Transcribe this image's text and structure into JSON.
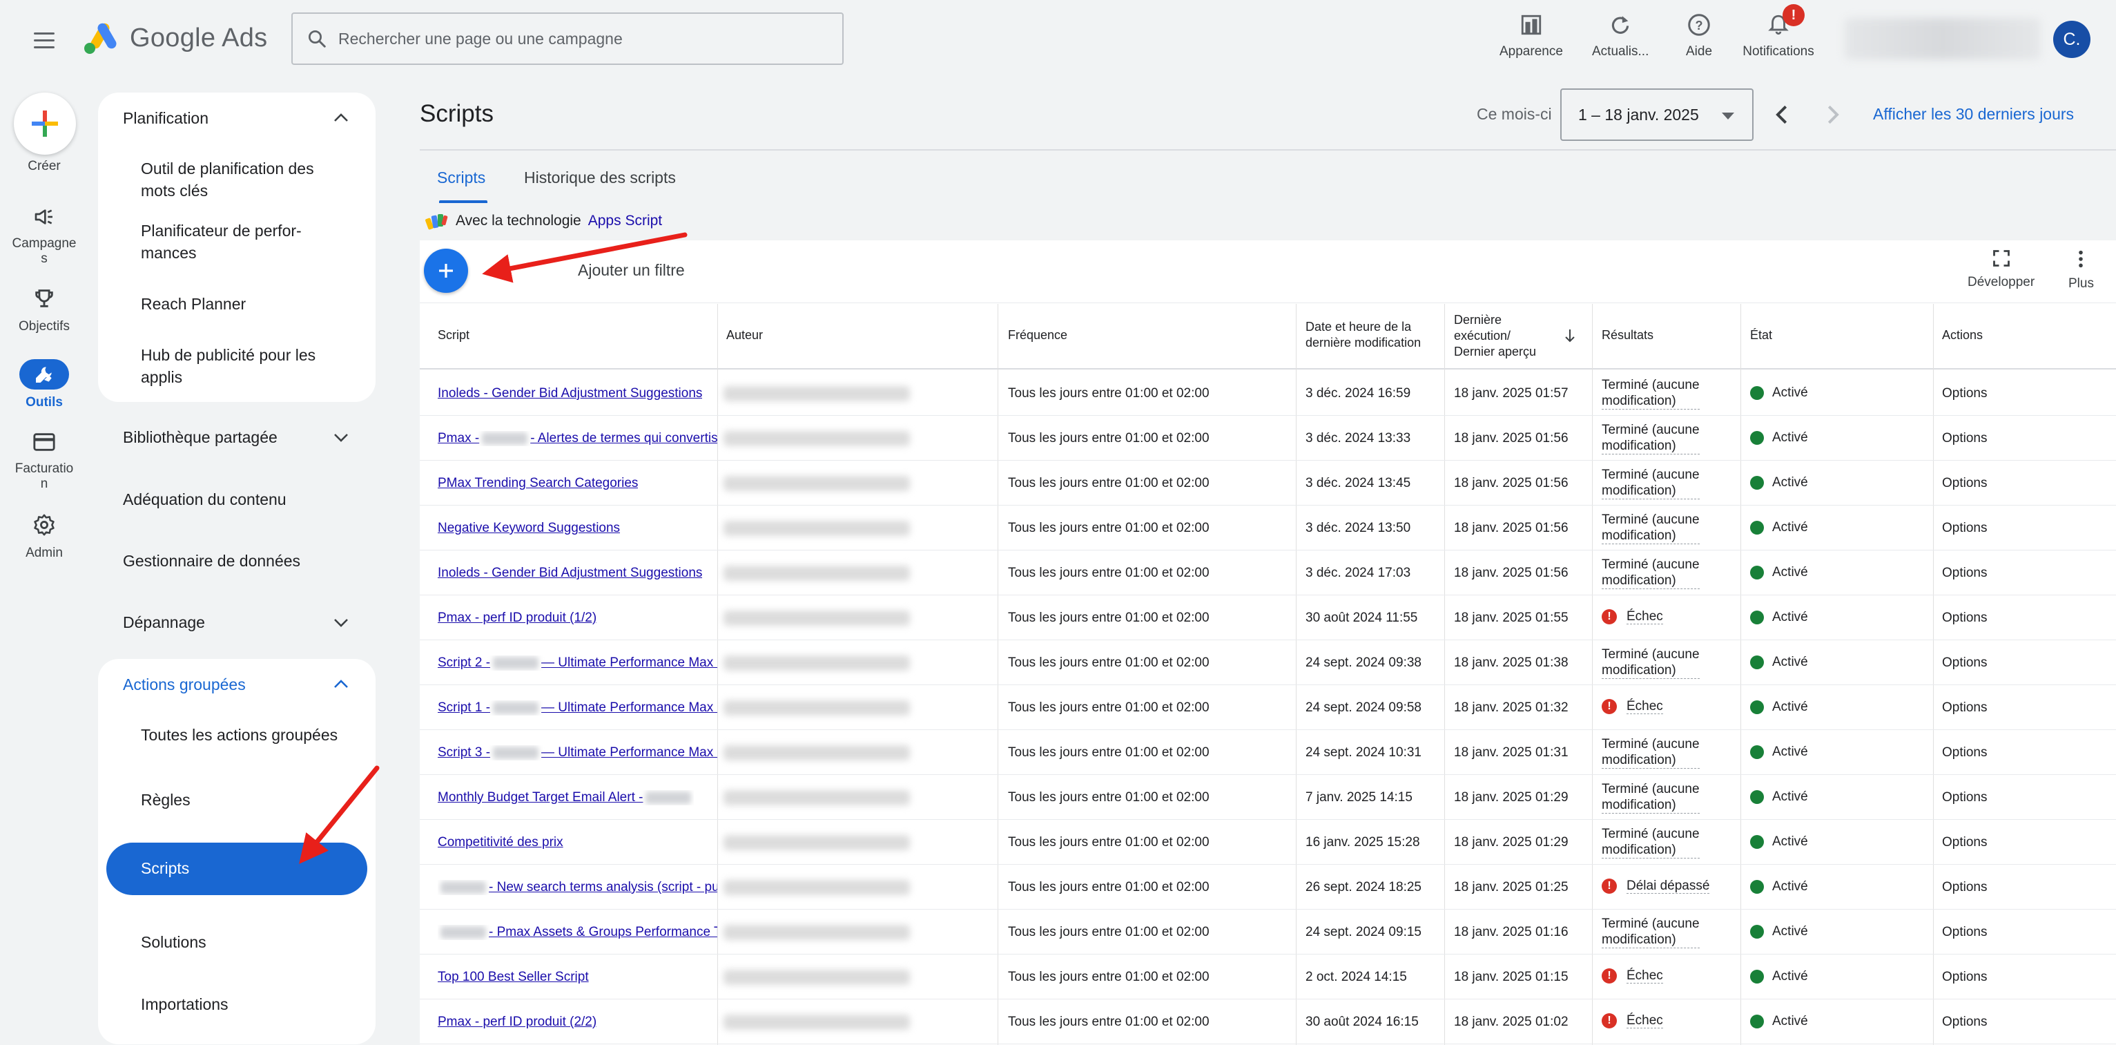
{
  "header": {
    "logo_text": "Google Ads",
    "search_placeholder": "Rechercher une page ou une campagne",
    "tools": [
      {
        "label": "Apparence"
      },
      {
        "label": "Actualis..."
      },
      {
        "label": "Aide"
      },
      {
        "label": "Notifications",
        "badge": "!"
      }
    ],
    "avatar_initial": "C."
  },
  "rail": {
    "create": "Créer",
    "items": [
      {
        "label_line1": "Campagne",
        "label_line2": "s"
      },
      {
        "label_line1": "Objectifs",
        "label_line2": ""
      },
      {
        "label_line1": "Outils",
        "label_line2": "",
        "active": true
      },
      {
        "label_line1": "Facturatio",
        "label_line2": "n"
      },
      {
        "label_line1": "Admin",
        "label_line2": ""
      }
    ]
  },
  "sidebar": {
    "planification": {
      "title": "Planification",
      "items": [
        "Outil de planification des mots clés",
        "Planificateur de perfor­mances",
        "Reach Planner",
        "Hub de publicité pour les applis"
      ]
    },
    "plain": [
      "Bibliothèque partagée",
      "Adéquation du contenu",
      "Gestionnaire de données",
      "Dépannage"
    ],
    "actions": {
      "title": "Actions groupées",
      "items": [
        "Toutes les actions grou­pées",
        "Règles",
        "Scripts",
        "Solutions",
        "Importations"
      ]
    }
  },
  "main": {
    "title": "Scripts",
    "period_label": "Ce mois-ci",
    "date_range": "1 – 18 janv. 2025",
    "last30": "Afficher les 30 derniers jours",
    "tabs": [
      "Scripts",
      "Historique des scripts"
    ],
    "powered_by": "Avec la technologie",
    "powered_link": "Apps Script",
    "add_filter": "Ajouter un filtre",
    "toolbar": {
      "expand": "Développer",
      "more": "Plus"
    },
    "columns": {
      "script": "Script",
      "author": "Auteur",
      "frequency": "Fréquence",
      "modified_1": "Date et heure de la",
      "modified_2": "dernière modification",
      "last_run_1": "Dernière",
      "last_run_2": "exécution/",
      "last_run_3": "Dernier aperçu",
      "results": "Résultats",
      "state": "État",
      "actions": "Actions"
    },
    "rows": [
      {
        "script_pre": "",
        "script": "Inoleds - Gender Bid Adjustment Suggestions",
        "frequency": "Tous les jours entre 01:00 et 02:00",
        "modified": "3 déc. 2024 16:59",
        "last_run": "18 janv. 2025 01:57",
        "result_1": "Terminé (aucune",
        "result_2": "modification)",
        "status": "Activé",
        "action": "Options"
      },
      {
        "script_pre": "Pmax -",
        "script": "- Alertes de termes qui convertis",
        "frequency": "Tous les jours entre 01:00 et 02:00",
        "modified": "3 déc. 2024 13:33",
        "last_run": "18 janv. 2025 01:56",
        "result_1": "Terminé (aucune",
        "result_2": "modification)",
        "status": "Activé",
        "action": "Options"
      },
      {
        "script_pre": "",
        "script": "PMax Trending Search Categories",
        "frequency": "Tous les jours entre 01:00 et 02:00",
        "modified": "3 déc. 2024 13:45",
        "last_run": "18 janv. 2025 01:56",
        "result_1": "Terminé (aucune",
        "result_2": "modification)",
        "status": "Activé",
        "action": "Options"
      },
      {
        "script_pre": "",
        "script": "Negative Keyword Suggestions",
        "frequency": "Tous les jours entre 01:00 et 02:00",
        "modified": "3 déc. 2024 13:50",
        "last_run": "18 janv. 2025 01:56",
        "result_1": "Terminé (aucune",
        "result_2": "modification)",
        "status": "Activé",
        "action": "Options"
      },
      {
        "script_pre": "",
        "script": "Inoleds - Gender Bid Adjustment Suggestions",
        "frequency": "Tous les jours entre 01:00 et 02:00",
        "modified": "3 déc. 2024 17:03",
        "last_run": "18 janv. 2025 01:56",
        "result_1": "Terminé (aucune",
        "result_2": "modification)",
        "status": "Activé",
        "action": "Options"
      },
      {
        "script_pre": "",
        "script": "Pmax - perf ID produit (1/2)",
        "frequency": "Tous les jours entre 01:00 et 02:00",
        "modified": "30 août 2024 11:55",
        "last_run": "18 janv. 2025 01:55",
        "result_error": "Échec",
        "status": "Activé",
        "action": "Options"
      },
      {
        "script_pre": "Script 2 -",
        "script": "— Ultimate Performance Max I",
        "frequency": "Tous les jours entre 01:00 et 02:00",
        "modified": "24 sept. 2024 09:38",
        "last_run": "18 janv. 2025 01:38",
        "result_1": "Terminé (aucune",
        "result_2": "modification)",
        "status": "Activé",
        "action": "Options"
      },
      {
        "script_pre": "Script 1 -",
        "script": "— Ultimate Performance Max I",
        "frequency": "Tous les jours entre 01:00 et 02:00",
        "modified": "24 sept. 2024 09:58",
        "last_run": "18 janv. 2025 01:32",
        "result_error": "Échec",
        "status": "Activé",
        "action": "Options"
      },
      {
        "script_pre": "Script 3 -",
        "script": "— Ultimate Performance Max I",
        "frequency": "Tous les jours entre 01:00 et 02:00",
        "modified": "24 sept. 2024 10:31",
        "last_run": "18 janv. 2025 01:31",
        "result_1": "Terminé (aucune",
        "result_2": "modification)",
        "status": "Activé",
        "action": "Options"
      },
      {
        "script_pre": "",
        "script": "Monthly Budget Target Email Alert -",
        "frequency": "Tous les jours entre 01:00 et 02:00",
        "modified": "7 janv. 2025 14:15",
        "last_run": "18 janv. 2025 01:29",
        "result_1": "Terminé (aucune",
        "result_2": "modification)",
        "status": "Activé",
        "action": "Options"
      },
      {
        "script_pre": "",
        "script": "Competitivité des prix",
        "frequency": "Tous les jours entre 01:00 et 02:00",
        "modified": "16 janv. 2025 15:28",
        "last_run": "18 janv. 2025 01:29",
        "result_1": "Terminé (aucune",
        "result_2": "modification)",
        "status": "Activé",
        "action": "Options"
      },
      {
        "script_pre": "",
        "script": "- New search terms analysis (script - pul",
        "frequency": "Tous les jours entre 01:00 et 02:00",
        "modified": "26 sept. 2024 18:25",
        "last_run": "18 janv. 2025 01:25",
        "result_error": "Délai dépassé",
        "status": "Activé",
        "action": "Options"
      },
      {
        "script_pre": "",
        "script": "- Pmax Assets & Groups Performance T",
        "frequency": "Tous les jours entre 01:00 et 02:00",
        "modified": "24 sept. 2024 09:15",
        "last_run": "18 janv. 2025 01:16",
        "result_1": "Terminé (aucune",
        "result_2": "modification)",
        "status": "Activé",
        "action": "Options"
      },
      {
        "script_pre": "",
        "script": "Top 100 Best Seller Script",
        "frequency": "Tous les jours entre 01:00 et 02:00",
        "modified": "2 oct. 2024 14:15",
        "last_run": "18 janv. 2025 01:15",
        "result_error": "Échec",
        "status": "Activé",
        "action": "Options"
      },
      {
        "script_pre": "",
        "script": "Pmax - perf ID produit (2/2)",
        "frequency": "Tous les jours entre 01:00 et 02:00",
        "modified": "30 août 2024 16:15",
        "last_run": "18 janv. 2025 01:02",
        "result_error": "Échec",
        "status": "Activé",
        "action": "Options"
      }
    ]
  },
  "colors": {
    "accent": "#1967d2",
    "fab": "#1a73e8",
    "error": "#d93025",
    "active_green": "#188038",
    "arrow_annotation": "#e8201a"
  }
}
